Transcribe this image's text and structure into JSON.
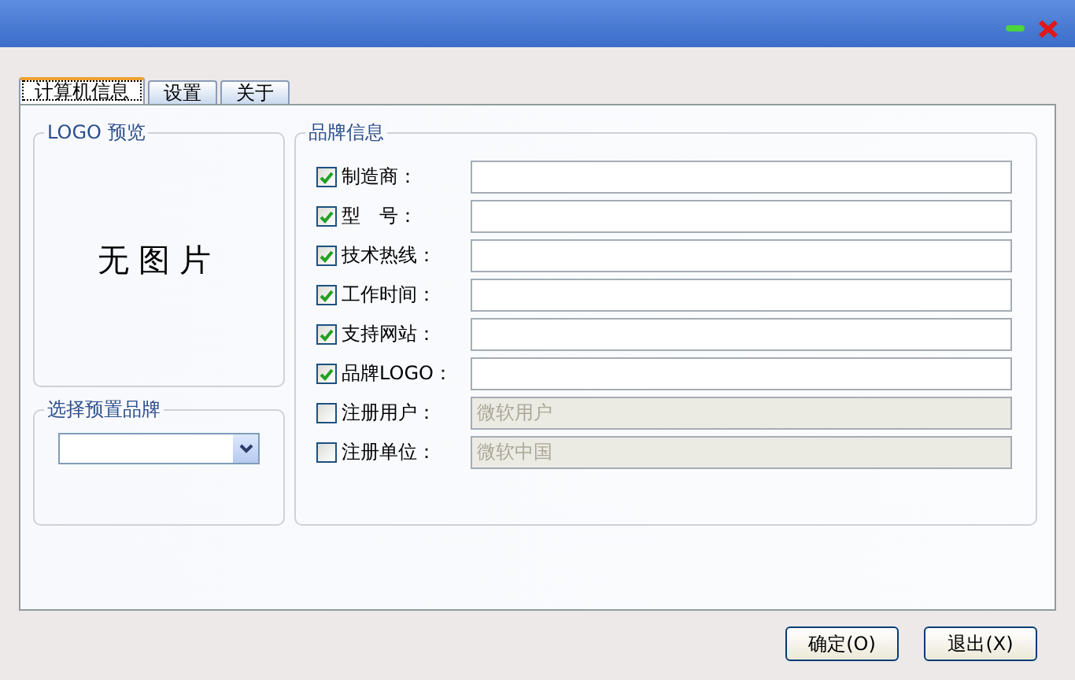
{
  "tabs": [
    {
      "label": "计算机信息",
      "selected": true
    },
    {
      "label": "设置",
      "selected": false
    },
    {
      "label": "关于",
      "selected": false
    }
  ],
  "logo_preview": {
    "title": "LOGO 预览",
    "placeholder_text": "无图片"
  },
  "preset_brand": {
    "title": "选择预置品牌"
  },
  "brand_info": {
    "title": "品牌信息",
    "rows": [
      {
        "label": "制造商：",
        "checked": true,
        "value": ""
      },
      {
        "label": "型　号：",
        "checked": true,
        "value": ""
      },
      {
        "label": "技术热线：",
        "checked": true,
        "value": ""
      },
      {
        "label": "工作时间：",
        "checked": true,
        "value": ""
      },
      {
        "label": "支持网站：",
        "checked": true,
        "value": ""
      },
      {
        "label": "品牌LOGO：",
        "checked": true,
        "value": ""
      },
      {
        "label": "注册用户：",
        "checked": false,
        "value": "微软用户"
      },
      {
        "label": "注册单位：",
        "checked": false,
        "value": "微软中国"
      }
    ]
  },
  "buttons": [
    "确定(O)",
    "退出(X)"
  ]
}
